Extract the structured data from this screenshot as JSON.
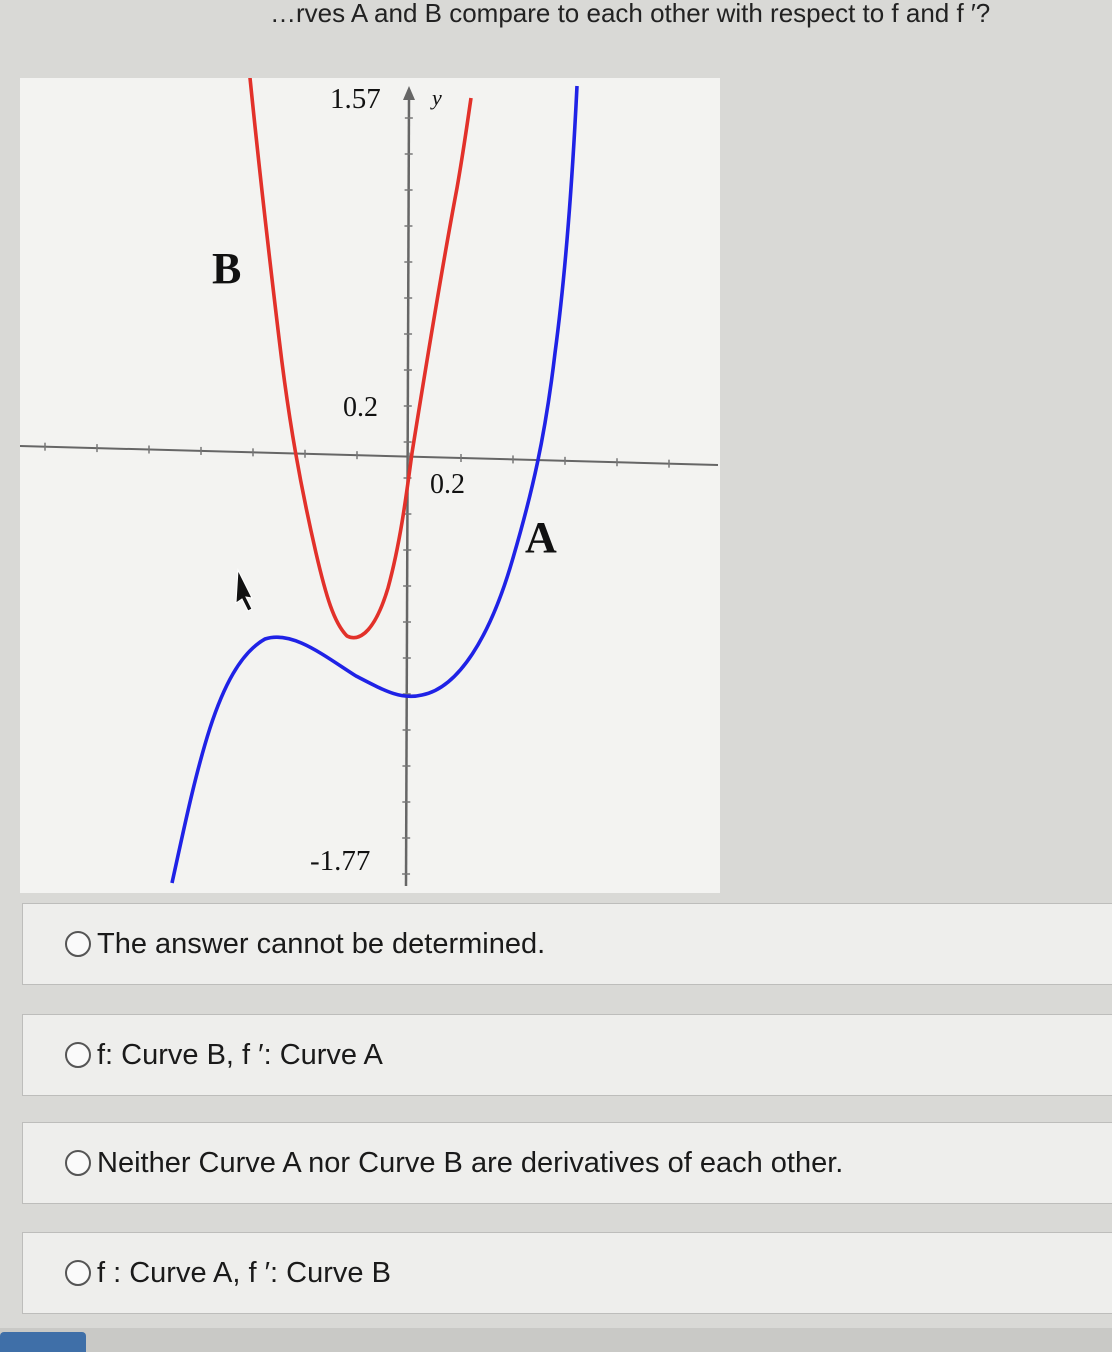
{
  "question": {
    "text": "…rves A and B compare to each other with respect to f and f ′?"
  },
  "graph": {
    "y_axis_label": "y",
    "y_top_label": "1.57",
    "y_bottom_label": "-1.77",
    "y_tick_label": "0.2",
    "x_tick_label": "0.2",
    "curve_a_label": "A",
    "curve_b_label": "B",
    "curve_a_color": "#1f22e6",
    "curve_b_color": "#e2312a"
  },
  "options": [
    {
      "label": "The answer cannot be determined."
    },
    {
      "label": "f: Curve B, f ′: Curve A"
    },
    {
      "label": "Neither Curve A nor Curve B are derivatives of each other."
    },
    {
      "label": "f : Curve A, f ′: Curve B"
    }
  ]
}
